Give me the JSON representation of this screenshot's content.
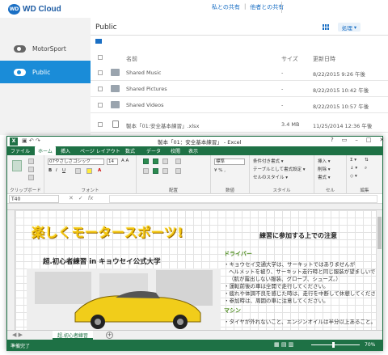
{
  "portal": {
    "logo": "WD Cloud",
    "links": [
      "私との共有",
      "他者との共有"
    ],
    "sidebar": [
      {
        "label": "MotorSport",
        "active": false
      },
      {
        "label": "Public",
        "active": true
      }
    ],
    "folder_title": "Public",
    "ops_button": "処理",
    "columns": {
      "name": "名前",
      "size": "サイズ",
      "updated": "更新日時"
    },
    "files": [
      {
        "name": "Shared Music",
        "size": "-",
        "date": "8/22/2015 9:26 午後",
        "type": "folder"
      },
      {
        "name": "Shared Pictures",
        "size": "-",
        "date": "8/22/2015 10:42 午後",
        "type": "folder"
      },
      {
        "name": "Shared Videos",
        "size": "-",
        "date": "8/22/2015 10:57 午後",
        "type": "folder"
      },
      {
        "name": "製本「01:安全基本練習」.xlsx",
        "size": "3.4 MB",
        "date": "11/25/2014 12:36 午後",
        "type": "file"
      }
    ]
  },
  "excel": {
    "caption": "製本「01：安全基本練習」 - Excel",
    "tabs": [
      "ファイル",
      "ホーム",
      "挿入",
      "ページ レイアウト",
      "数式",
      "データ",
      "校閲",
      "表示"
    ],
    "ribbon": {
      "font_name": "07やさしさゴシック",
      "font_size": "14",
      "number_format": "標準",
      "styles": [
        "条件付き書式 ▾",
        "テーブルとして書式設定 ▾",
        "セルのスタイル ▾"
      ],
      "cells": [
        "挿入 ▾",
        "削除 ▾",
        "書式 ▾"
      ],
      "groups": [
        "クリップボード",
        "フォント",
        "配置",
        "数値",
        "スタイル",
        "セル",
        "編集"
      ]
    },
    "name_box": "T40",
    "sheet": {
      "banner": "楽しくモータースポーツ!",
      "notes_title": "練習に参加する上での注意",
      "subtitle": "超.初心者練習 in キョウセイ公式大学",
      "section1": "ドライバー",
      "notes": [
        "・キョウセイ交通大学は、サーキットではありませんが",
        "ヘルメットを被り、サーキット走行時と同じ服装が望ましいです。",
        "（肌が露出しない服装、グローブ、シューズ。）",
        "・運転前後の車は全開で走行してください。",
        "・疲れや体調不良を感じた時は、走行を中断して休憩してください。",
        "・参加時は、周囲の車に注意してください。"
      ],
      "section2": "マシン",
      "notes2": [
        "・タイヤが外れないこと、エンジンオイルは半分以上あること。"
      ]
    },
    "sheet_tab": "超.初心者練習",
    "status": "準備完了",
    "zoom": "70%"
  }
}
